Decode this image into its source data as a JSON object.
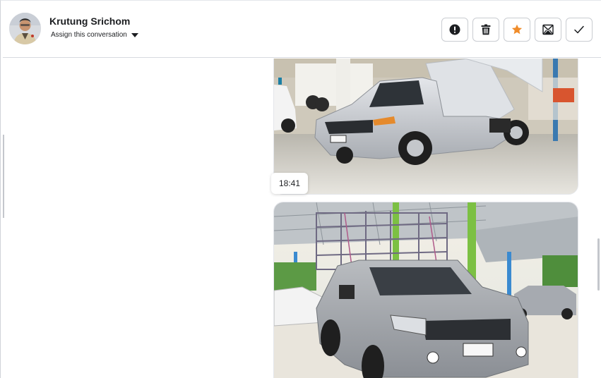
{
  "contact": {
    "name": "Krutung Srichom",
    "assign_label": "Assign this conversation"
  },
  "actions": [
    {
      "name": "report-button",
      "icon": "exclamation-circle-icon"
    },
    {
      "name": "delete-button",
      "icon": "trash-icon"
    },
    {
      "name": "star-button",
      "icon": "star-icon",
      "color": "#f08c2a"
    },
    {
      "name": "mark-unread-button",
      "icon": "envelope-icon"
    },
    {
      "name": "done-button",
      "icon": "check-icon"
    }
  ],
  "messages": [
    {
      "type": "image",
      "subject": "silver pickup truck with tipper bed in dealership"
    },
    {
      "type": "image",
      "subject": "silver pickup truck with cargo rack under green-pillar canopy"
    }
  ],
  "timestamp": "18:41",
  "colors": {
    "accent": "#f08c2a",
    "border": "#c9ccd1"
  }
}
